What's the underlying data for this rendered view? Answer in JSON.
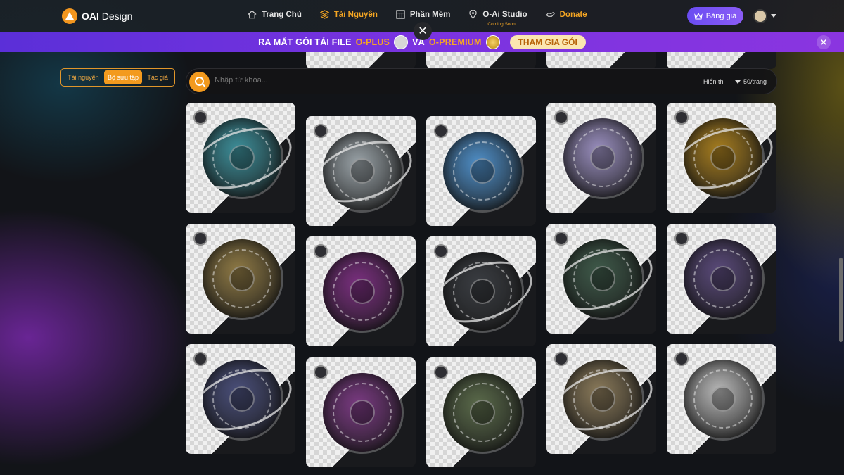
{
  "header": {
    "logo_bold": "OAI",
    "logo_text": " Design",
    "nav": [
      {
        "label": "Trang Chủ",
        "icon": "home-icon"
      },
      {
        "label": "Tài Nguyên",
        "icon": "layers-icon",
        "active": true
      },
      {
        "label": "Phần Mềm",
        "icon": "grid-icon"
      },
      {
        "label": "O-Ai Studio",
        "icon": "location-icon",
        "sub": "Coming Soon"
      },
      {
        "label": "Donate",
        "icon": "donate-icon"
      }
    ],
    "pricing_label": "Bảng giá",
    "close_symbol": "✕"
  },
  "promo": {
    "text_before": "RA MẮT GÓI TẢI FILE ",
    "plan1": "O-PLUS",
    "and": "VÀ ",
    "plan2": "O-PREMIUM",
    "cta": "THAM GIA GÓI",
    "close_symbol": "✕"
  },
  "filter_tabs": [
    "Tài nguyên",
    "Bộ sưu tập",
    "Tác giả"
  ],
  "search": {
    "placeholder": "Nhập từ khóa...",
    "per_page_label": "Hiển thị",
    "per_page_value": "50/trang"
  },
  "colors": {
    "accent": "#f39a1e",
    "promo": "#7a33e0",
    "pricing": "#7c55f4"
  },
  "cards": [
    {
      "disc": "#3d8f9a"
    },
    {
      "disc": "#9aa3a8"
    },
    {
      "disc": "#4f8fc8"
    },
    {
      "disc": "#9a8fbf"
    },
    {
      "disc": "#a67d1f"
    },
    {
      "disc": "#8f7a45"
    },
    {
      "disc": "#7a2f7f"
    },
    {
      "disc": "#3a3d42"
    },
    {
      "disc": "#3f5a4a"
    },
    {
      "disc": "#5a4a7a"
    },
    {
      "disc": "#4a4f7a"
    },
    {
      "disc": "#7a3a82"
    },
    {
      "disc": "#5a6a4a"
    },
    {
      "disc": "#8a7a5a"
    },
    {
      "disc": "#b8b8b8"
    }
  ]
}
